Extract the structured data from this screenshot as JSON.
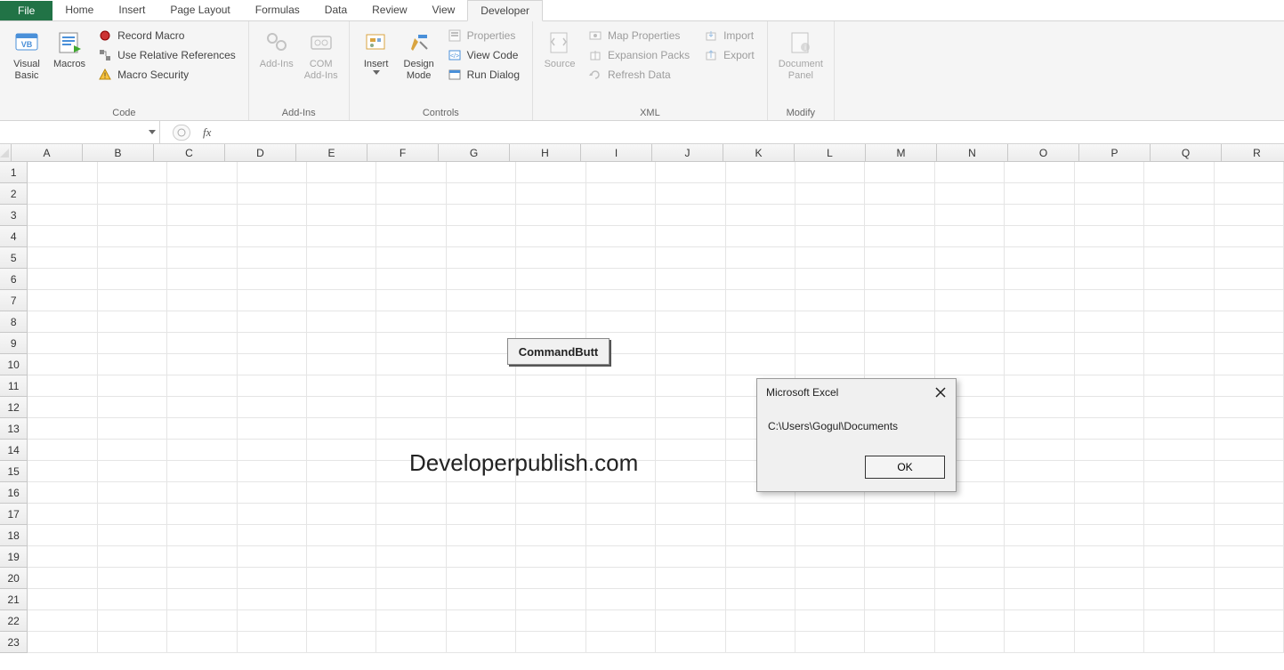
{
  "tabs": {
    "file": "File",
    "items": [
      "Home",
      "Insert",
      "Page Layout",
      "Formulas",
      "Data",
      "Review",
      "View",
      "Developer"
    ],
    "active": "Developer"
  },
  "ribbon": {
    "code": {
      "label": "Code",
      "visual_basic": "Visual\nBasic",
      "macros": "Macros",
      "record_macro": "Record Macro",
      "use_relative": "Use Relative References",
      "macro_security": "Macro Security"
    },
    "addins": {
      "label": "Add-Ins",
      "addins": "Add-Ins",
      "com_addins": "COM\nAdd-Ins"
    },
    "controls": {
      "label": "Controls",
      "insert": "Insert",
      "design_mode": "Design\nMode",
      "properties": "Properties",
      "view_code": "View Code",
      "run_dialog": "Run Dialog"
    },
    "xml": {
      "label": "XML",
      "source": "Source",
      "map_properties": "Map Properties",
      "expansion_packs": "Expansion Packs",
      "refresh_data": "Refresh Data",
      "import": "Import",
      "export": "Export"
    },
    "modify": {
      "label": "Modify",
      "document_panel": "Document\nPanel"
    }
  },
  "formula_bar": {
    "name_box": "",
    "fx": "fx",
    "value": ""
  },
  "grid": {
    "columns": [
      "A",
      "B",
      "C",
      "D",
      "E",
      "F",
      "G",
      "H",
      "I",
      "J",
      "K",
      "L",
      "M",
      "N",
      "O",
      "P",
      "Q",
      "R"
    ],
    "rows": 23
  },
  "overlay": {
    "command_button": "CommandButt",
    "watermark": "Developerpublish.com"
  },
  "msgbox": {
    "title": "Microsoft Excel",
    "body": "C:\\Users\\Gogul\\Documents",
    "ok": "OK"
  }
}
